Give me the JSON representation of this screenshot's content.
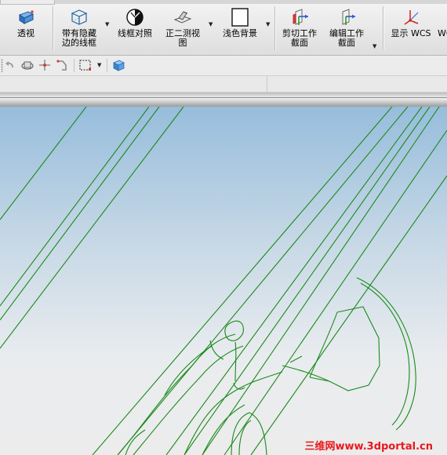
{
  "ribbon": {
    "commands": [
      {
        "label": "透视",
        "icon": "perspective-cube-icon"
      },
      {
        "label": "带有隐藏\n边的线框",
        "icon": "wireframe-hidden-edges-icon"
      },
      {
        "label": "线框对照",
        "icon": "wireframe-contrast-icon"
      },
      {
        "label": "正二测视\n图",
        "icon": "dimetric-view-icon"
      },
      {
        "label": "浅色背景",
        "icon": "light-background-icon"
      },
      {
        "label": "剪切工作\n截面",
        "icon": "clip-work-section-icon"
      },
      {
        "label": "编辑工作\n截面",
        "icon": "edit-work-section-icon"
      },
      {
        "label": "显示 WCS",
        "icon": "wcs-axes-icon"
      },
      {
        "label": "WC",
        "icon": ""
      }
    ]
  },
  "toolbar": {
    "icons": [
      "undo-icon",
      "rotate-view-icon",
      "pan-icon",
      "select-tool-icon",
      "box-select-icon",
      "view-cube-icon"
    ]
  },
  "colors": {
    "wireframe": "#1a8a1a",
    "viewport_top": "#97bddc",
    "viewport_bottom": "#ececec",
    "watermark": "#e8191b"
  },
  "watermark": {
    "text": "三维网www.3dportal.cn"
  }
}
